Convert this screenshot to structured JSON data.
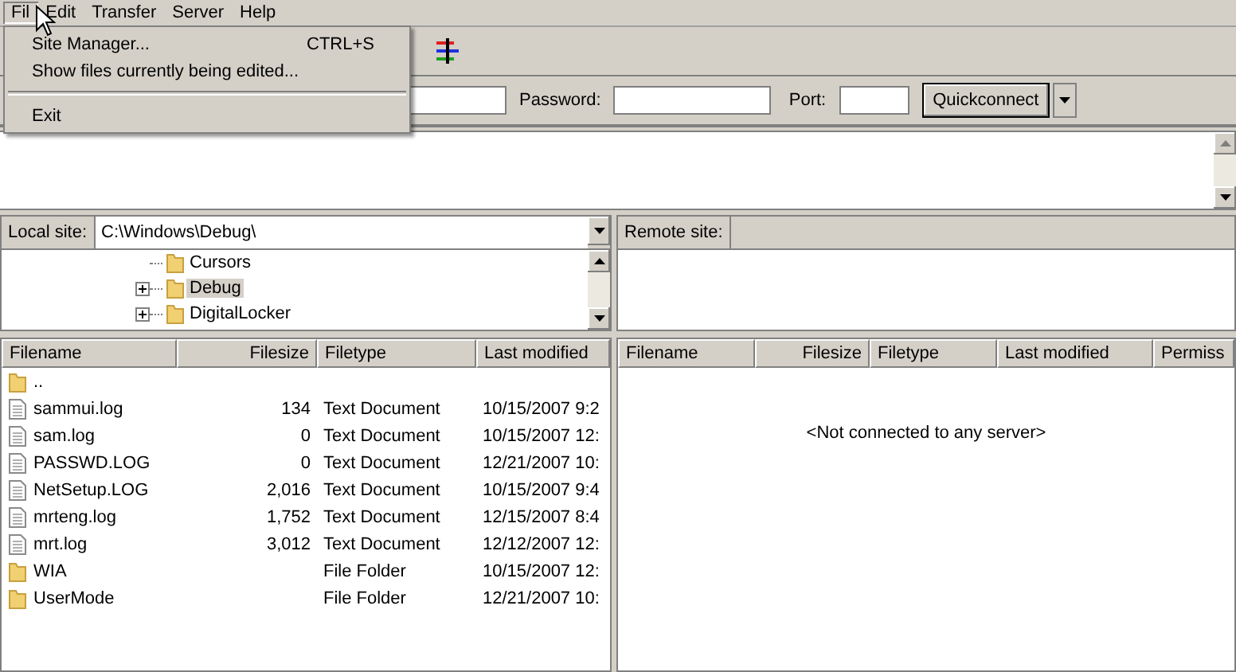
{
  "menu_bar": [
    {
      "label": "Fil",
      "selected": true
    },
    {
      "label": "Edit",
      "selected": false
    },
    {
      "label": "Transfer",
      "selected": false
    },
    {
      "label": "Server",
      "selected": false
    },
    {
      "label": "Help",
      "selected": false
    }
  ],
  "file_menu": [
    {
      "kind": "item",
      "label": "Site Manager...",
      "shortcut": "CTRL+S"
    },
    {
      "kind": "item",
      "label": "Show files currently being edited..."
    },
    {
      "kind": "separator"
    },
    {
      "kind": "item",
      "label": "Exit"
    }
  ],
  "quickconnect": {
    "fields": [
      {
        "label": "Password:"
      },
      {
        "label": "Port:"
      }
    ],
    "button": "Quickconnect"
  },
  "local": {
    "site_label": "Local site:",
    "path": "C:\\Windows\\Debug\\",
    "tree": [
      {
        "label": "Cursors",
        "expandable": false,
        "selected": false
      },
      {
        "label": "Debug",
        "expandable": true,
        "selected": true
      },
      {
        "label": "DigitalLocker",
        "expandable": true,
        "selected": false
      }
    ],
    "columns": [
      "Filename",
      "Filesize",
      "Filetype",
      "Last modified"
    ],
    "rows": [
      {
        "kind": "folder",
        "name": "..",
        "size": "",
        "type": "",
        "modified": ""
      },
      {
        "kind": "file",
        "name": "sammui.log",
        "size": "134",
        "type": "Text Document",
        "modified": "10/15/2007 9:2"
      },
      {
        "kind": "file",
        "name": "sam.log",
        "size": "0",
        "type": "Text Document",
        "modified": "10/15/2007 12:"
      },
      {
        "kind": "file",
        "name": "PASSWD.LOG",
        "size": "0",
        "type": "Text Document",
        "modified": "12/21/2007 10:"
      },
      {
        "kind": "file",
        "name": "NetSetup.LOG",
        "size": "2,016",
        "type": "Text Document",
        "modified": "10/15/2007 9:4"
      },
      {
        "kind": "file",
        "name": "mrteng.log",
        "size": "1,752",
        "type": "Text Document",
        "modified": "12/15/2007 8:4"
      },
      {
        "kind": "file",
        "name": "mrt.log",
        "size": "3,012",
        "type": "Text Document",
        "modified": "12/12/2007 12:"
      },
      {
        "kind": "folder",
        "name": "WIA",
        "size": "",
        "type": "File Folder",
        "modified": "10/15/2007 12:"
      },
      {
        "kind": "folder",
        "name": "UserMode",
        "size": "",
        "type": "File Folder",
        "modified": "12/21/2007 10:"
      }
    ]
  },
  "remote": {
    "site_label": "Remote site:",
    "columns": [
      "Filename",
      "Filesize",
      "Filetype",
      "Last modified",
      "Permiss"
    ],
    "empty_message": "<Not connected to any server>"
  }
}
